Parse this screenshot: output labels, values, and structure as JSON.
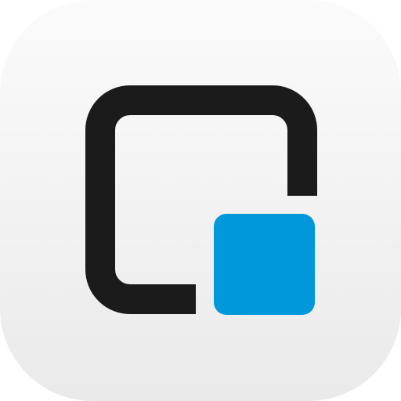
{
  "icon": {
    "name": "picture-in-picture-app-icon",
    "colors": {
      "tile_top": "#fbfbfb",
      "tile_bottom": "#eaeaea",
      "outline": "#1b1b1b",
      "accent": "#0098da"
    }
  }
}
